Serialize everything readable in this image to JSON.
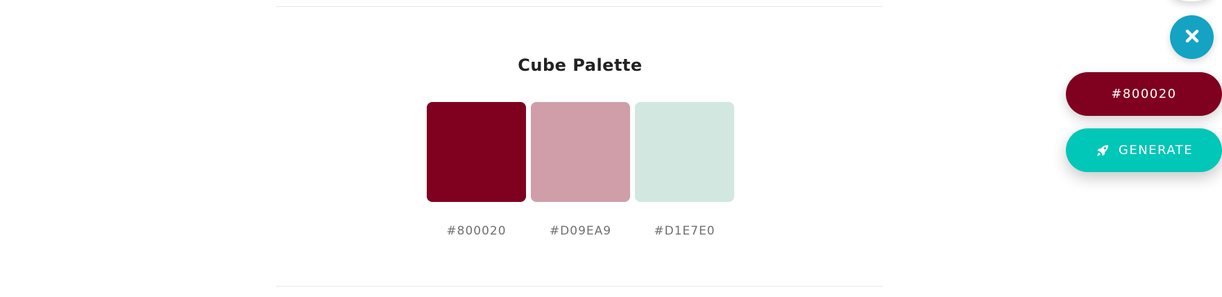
{
  "palette": {
    "title": "Cube Palette",
    "swatches": [
      {
        "hex": "#800020",
        "label": "#800020"
      },
      {
        "hex": "#D09EA9",
        "label": "#D09EA9"
      },
      {
        "hex": "#D1E7E0",
        "label": "#D1E7E0"
      }
    ]
  },
  "controls": {
    "close_icon": "close-icon",
    "close_color": "#14a3c2",
    "current_color_label": "#800020",
    "current_color_bg": "#800020",
    "generate_label": "GENERATE",
    "generate_icon": "rocket-icon",
    "generate_bg": "#00c7b7"
  }
}
